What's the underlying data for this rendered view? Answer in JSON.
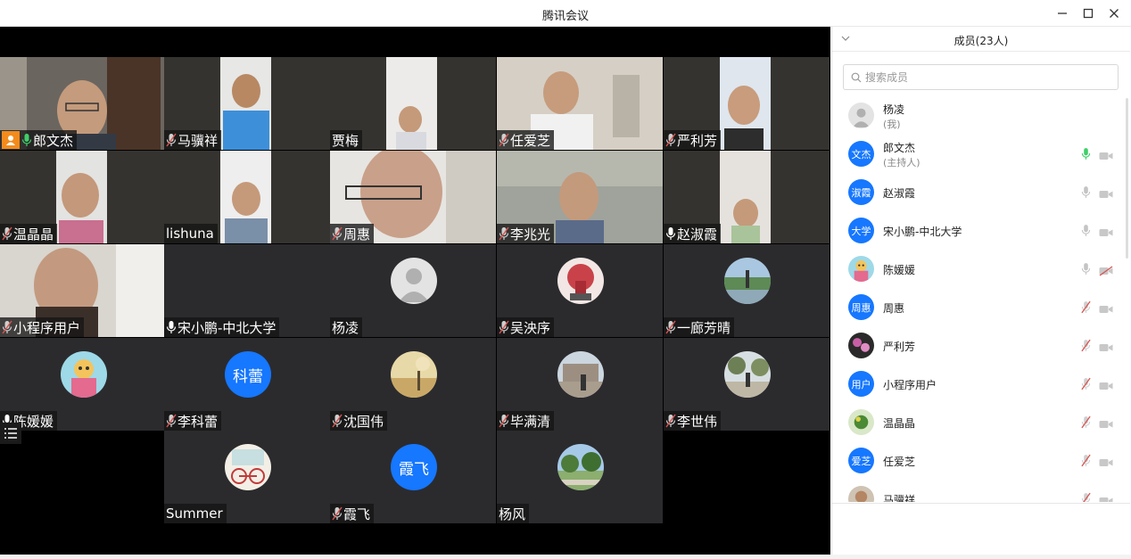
{
  "window": {
    "title": "腾讯会议"
  },
  "colors": {
    "accent": "#1677ff",
    "host_badge": "#f28b1c",
    "mic_active": "#3fcf6a",
    "muted": "#d9534f"
  },
  "video_grid": {
    "tiles": [
      {
        "name": "郎文杰",
        "type": "camera",
        "mic": "active",
        "host": true,
        "selected": true
      },
      {
        "name": "马骥祥",
        "type": "camera",
        "mic": "muted"
      },
      {
        "name": "贾梅",
        "type": "camera",
        "mic": "none"
      },
      {
        "name": "任爱芝",
        "type": "camera",
        "mic": "muted"
      },
      {
        "name": "严利芳",
        "type": "camera",
        "mic": "muted"
      },
      {
        "name": "温晶晶",
        "type": "camera",
        "mic": "muted"
      },
      {
        "name": "lishuna",
        "type": "camera",
        "mic": "none"
      },
      {
        "name": "周惠",
        "type": "camera",
        "mic": "muted"
      },
      {
        "name": "李兆光",
        "type": "camera",
        "mic": "muted"
      },
      {
        "name": "赵淑霞",
        "type": "camera",
        "mic": "on"
      },
      {
        "name": "小程序用户",
        "type": "camera",
        "mic": "muted"
      },
      {
        "name": "宋小鹏-中北大学",
        "type": "blank",
        "mic": "on"
      },
      {
        "name": "杨凌",
        "type": "avatar",
        "avatar_kind": "default",
        "mic": "none"
      },
      {
        "name": "吴泱序",
        "type": "avatar",
        "avatar_kind": "photo-umbrella",
        "mic": "muted"
      },
      {
        "name": "一廊芳晴",
        "type": "avatar",
        "avatar_kind": "photo-lake",
        "mic": "muted"
      },
      {
        "name": "陈媛媛",
        "type": "avatar",
        "avatar_kind": "photo-cartoon",
        "mic": "on"
      },
      {
        "name": "李科蕾",
        "type": "avatar",
        "avatar_kind": "text",
        "avatar_text": "科蕾",
        "mic": "muted"
      },
      {
        "name": "沈国伟",
        "type": "avatar",
        "avatar_kind": "photo-field",
        "mic": "muted"
      },
      {
        "name": "毕满清",
        "type": "avatar",
        "avatar_kind": "photo-building",
        "mic": "muted"
      },
      {
        "name": "李世伟",
        "type": "avatar",
        "avatar_kind": "photo-trees",
        "mic": "muted"
      },
      {
        "name": "Summer",
        "type": "avatar",
        "avatar_kind": "photo-bicycle",
        "mic": "none"
      },
      {
        "name": "霞飞",
        "type": "avatar",
        "avatar_kind": "text",
        "avatar_text": "霞飞",
        "mic": "muted"
      },
      {
        "name": "杨风",
        "type": "avatar",
        "avatar_kind": "photo-palm",
        "mic": "none"
      }
    ]
  },
  "members_panel": {
    "title": "成员(23人)",
    "search_placeholder": "搜索成员",
    "members": [
      {
        "name": "杨凌",
        "role": "(我)",
        "avatar_kind": "default",
        "mic": "none",
        "cam": "none"
      },
      {
        "name": "郎文杰",
        "role": "(主持人)",
        "avatar_kind": "text",
        "avatar_text": "文杰",
        "mic": "active",
        "cam": "on"
      },
      {
        "name": "赵淑霞",
        "avatar_kind": "text",
        "avatar_text": "淑霞",
        "mic": "on",
        "cam": "on"
      },
      {
        "name": "宋小鹏-中北大学",
        "avatar_kind": "text",
        "avatar_text": "大学",
        "mic": "on",
        "cam": "on"
      },
      {
        "name": "陈媛媛",
        "avatar_kind": "photo-cartoon",
        "mic": "on",
        "cam": "off"
      },
      {
        "name": "周惠",
        "avatar_kind": "text",
        "avatar_text": "周惠",
        "mic": "muted",
        "cam": "on"
      },
      {
        "name": "严利芳",
        "avatar_kind": "photo-flower",
        "mic": "muted",
        "cam": "on"
      },
      {
        "name": "小程序用户",
        "avatar_kind": "text",
        "avatar_text": "用户",
        "mic": "muted",
        "cam": "on"
      },
      {
        "name": "温晶晶",
        "avatar_kind": "photo-plant",
        "mic": "muted",
        "cam": "on"
      },
      {
        "name": "任爱芝",
        "avatar_kind": "text",
        "avatar_text": "爱芝",
        "mic": "muted",
        "cam": "on"
      },
      {
        "name": "马骥祥",
        "avatar_kind": "photo-portrait",
        "mic": "muted",
        "cam": "on"
      }
    ]
  }
}
